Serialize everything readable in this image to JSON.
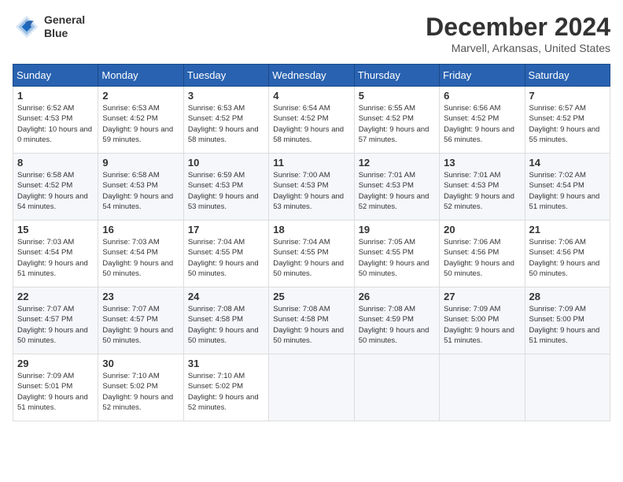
{
  "logo": {
    "line1": "General",
    "line2": "Blue"
  },
  "title": "December 2024",
  "location": "Marvell, Arkansas, United States",
  "weekdays": [
    "Sunday",
    "Monday",
    "Tuesday",
    "Wednesday",
    "Thursday",
    "Friday",
    "Saturday"
  ],
  "weeks": [
    [
      {
        "day": "1",
        "sunrise": "6:52 AM",
        "sunset": "4:53 PM",
        "daylight": "10 hours and 0 minutes."
      },
      {
        "day": "2",
        "sunrise": "6:53 AM",
        "sunset": "4:52 PM",
        "daylight": "9 hours and 59 minutes."
      },
      {
        "day": "3",
        "sunrise": "6:53 AM",
        "sunset": "4:52 PM",
        "daylight": "9 hours and 58 minutes."
      },
      {
        "day": "4",
        "sunrise": "6:54 AM",
        "sunset": "4:52 PM",
        "daylight": "9 hours and 58 minutes."
      },
      {
        "day": "5",
        "sunrise": "6:55 AM",
        "sunset": "4:52 PM",
        "daylight": "9 hours and 57 minutes."
      },
      {
        "day": "6",
        "sunrise": "6:56 AM",
        "sunset": "4:52 PM",
        "daylight": "9 hours and 56 minutes."
      },
      {
        "day": "7",
        "sunrise": "6:57 AM",
        "sunset": "4:52 PM",
        "daylight": "9 hours and 55 minutes."
      }
    ],
    [
      {
        "day": "8",
        "sunrise": "6:58 AM",
        "sunset": "4:52 PM",
        "daylight": "9 hours and 54 minutes."
      },
      {
        "day": "9",
        "sunrise": "6:58 AM",
        "sunset": "4:53 PM",
        "daylight": "9 hours and 54 minutes."
      },
      {
        "day": "10",
        "sunrise": "6:59 AM",
        "sunset": "4:53 PM",
        "daylight": "9 hours and 53 minutes."
      },
      {
        "day": "11",
        "sunrise": "7:00 AM",
        "sunset": "4:53 PM",
        "daylight": "9 hours and 53 minutes."
      },
      {
        "day": "12",
        "sunrise": "7:01 AM",
        "sunset": "4:53 PM",
        "daylight": "9 hours and 52 minutes."
      },
      {
        "day": "13",
        "sunrise": "7:01 AM",
        "sunset": "4:53 PM",
        "daylight": "9 hours and 52 minutes."
      },
      {
        "day": "14",
        "sunrise": "7:02 AM",
        "sunset": "4:54 PM",
        "daylight": "9 hours and 51 minutes."
      }
    ],
    [
      {
        "day": "15",
        "sunrise": "7:03 AM",
        "sunset": "4:54 PM",
        "daylight": "9 hours and 51 minutes."
      },
      {
        "day": "16",
        "sunrise": "7:03 AM",
        "sunset": "4:54 PM",
        "daylight": "9 hours and 50 minutes."
      },
      {
        "day": "17",
        "sunrise": "7:04 AM",
        "sunset": "4:55 PM",
        "daylight": "9 hours and 50 minutes."
      },
      {
        "day": "18",
        "sunrise": "7:04 AM",
        "sunset": "4:55 PM",
        "daylight": "9 hours and 50 minutes."
      },
      {
        "day": "19",
        "sunrise": "7:05 AM",
        "sunset": "4:55 PM",
        "daylight": "9 hours and 50 minutes."
      },
      {
        "day": "20",
        "sunrise": "7:06 AM",
        "sunset": "4:56 PM",
        "daylight": "9 hours and 50 minutes."
      },
      {
        "day": "21",
        "sunrise": "7:06 AM",
        "sunset": "4:56 PM",
        "daylight": "9 hours and 50 minutes."
      }
    ],
    [
      {
        "day": "22",
        "sunrise": "7:07 AM",
        "sunset": "4:57 PM",
        "daylight": "9 hours and 50 minutes."
      },
      {
        "day": "23",
        "sunrise": "7:07 AM",
        "sunset": "4:57 PM",
        "daylight": "9 hours and 50 minutes."
      },
      {
        "day": "24",
        "sunrise": "7:08 AM",
        "sunset": "4:58 PM",
        "daylight": "9 hours and 50 minutes."
      },
      {
        "day": "25",
        "sunrise": "7:08 AM",
        "sunset": "4:58 PM",
        "daylight": "9 hours and 50 minutes."
      },
      {
        "day": "26",
        "sunrise": "7:08 AM",
        "sunset": "4:59 PM",
        "daylight": "9 hours and 50 minutes."
      },
      {
        "day": "27",
        "sunrise": "7:09 AM",
        "sunset": "5:00 PM",
        "daylight": "9 hours and 51 minutes."
      },
      {
        "day": "28",
        "sunrise": "7:09 AM",
        "sunset": "5:00 PM",
        "daylight": "9 hours and 51 minutes."
      }
    ],
    [
      {
        "day": "29",
        "sunrise": "7:09 AM",
        "sunset": "5:01 PM",
        "daylight": "9 hours and 51 minutes."
      },
      {
        "day": "30",
        "sunrise": "7:10 AM",
        "sunset": "5:02 PM",
        "daylight": "9 hours and 52 minutes."
      },
      {
        "day": "31",
        "sunrise": "7:10 AM",
        "sunset": "5:02 PM",
        "daylight": "9 hours and 52 minutes."
      },
      null,
      null,
      null,
      null
    ]
  ]
}
